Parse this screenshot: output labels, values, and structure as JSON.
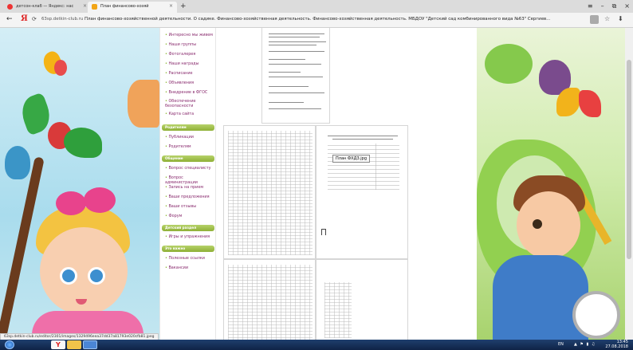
{
  "browser": {
    "tabs": [
      {
        "title": "детсон-клаб — Яндекс: нас",
        "active": false
      },
      {
        "title": "План финансово-хозяй",
        "active": true
      }
    ],
    "close_glyph": "×",
    "new_tab_glyph": "+",
    "window_buttons": [
      "≡",
      "–",
      "⧉",
      "×"
    ],
    "back_glyph": "←",
    "reload_glyph": "⟳",
    "url_domain": "63sp.detkin-club.ru",
    "page_title": "План финансово-хозяйственной деятельности. О садике. Финансово-хозяйственная деятельность. Финансово-хозяйственная деятельность. МБДОУ \"Детский сад комбинированного вида №63\" Сергиев...",
    "star_glyph": "☆",
    "download_glyph": "⬇"
  },
  "sidebar": {
    "items_top": [
      "Интересно мы живем",
      "Наши группы",
      "Фотогалерея",
      "Наши награды",
      "Расписание",
      "Объявления",
      "Внедрение в ФГОС",
      "Обеспечение безопасности",
      "Карта сайта"
    ],
    "head_parents": "Родителям",
    "items_parents": [
      "Публикации",
      "Родителям"
    ],
    "head_common": "Общение",
    "items_common": [
      "Вопрос специалисту",
      "Вопрос администрации",
      "Запись на прием",
      "Ваши предложения",
      "Ваши отзывы",
      "Форум"
    ],
    "head_kids": "Детский раздел",
    "items_kids": [
      "Игры и упражнения"
    ],
    "head_other": "Это важно",
    "items_other": [
      "Полезные ссылки",
      "Вакансии"
    ]
  },
  "viewer": {
    "tooltip": "План ФХД3.jpg"
  },
  "status_url": "63sp.detkin-club.ru/editor/2301/images/1329496eea37dd37a81793e020cfb81.jpeg",
  "taskbar": {
    "lang": "EN",
    "tray_icons": "▲ ⚑ ▮ ♫",
    "time": "13:45",
    "date": "27.08.2018"
  }
}
